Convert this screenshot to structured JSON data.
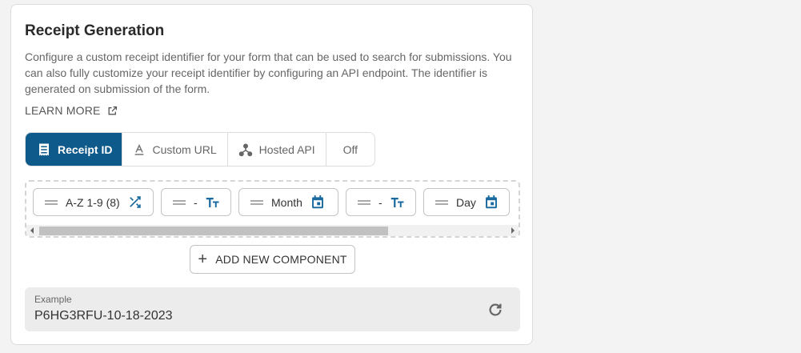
{
  "section": {
    "title": "Receipt Generation",
    "description": "Configure a custom receipt identifier for your form that can be used to search for submissions. You can also fully customize your receipt identifier by configuring an API endpoint. The identifier is generated on submission of the form.",
    "learn_more": "LEARN MORE"
  },
  "tabs": [
    {
      "label": "Receipt ID",
      "icon": "receipt-icon",
      "active": true
    },
    {
      "label": "Custom URL",
      "icon": "text-format-icon",
      "active": false
    },
    {
      "label": "Hosted API",
      "icon": "api-icon",
      "active": false
    },
    {
      "label": "Off",
      "icon": null,
      "active": false
    }
  ],
  "components": [
    {
      "label": "A-Z 1-9 (8)",
      "icon": "shuffle-icon"
    },
    {
      "label": "-",
      "icon": "text-size-icon"
    },
    {
      "label": "Month",
      "icon": "calendar-icon"
    },
    {
      "label": "-",
      "icon": "text-size-icon"
    },
    {
      "label": "Day",
      "icon": "calendar-icon"
    }
  ],
  "add_component_label": "ADD NEW COMPONENT",
  "example": {
    "label": "Example",
    "value": "P6HG3RFU-10-18-2023"
  },
  "colors": {
    "accent": "#0e5a8a",
    "icon_blue": "#1a6aa0"
  }
}
